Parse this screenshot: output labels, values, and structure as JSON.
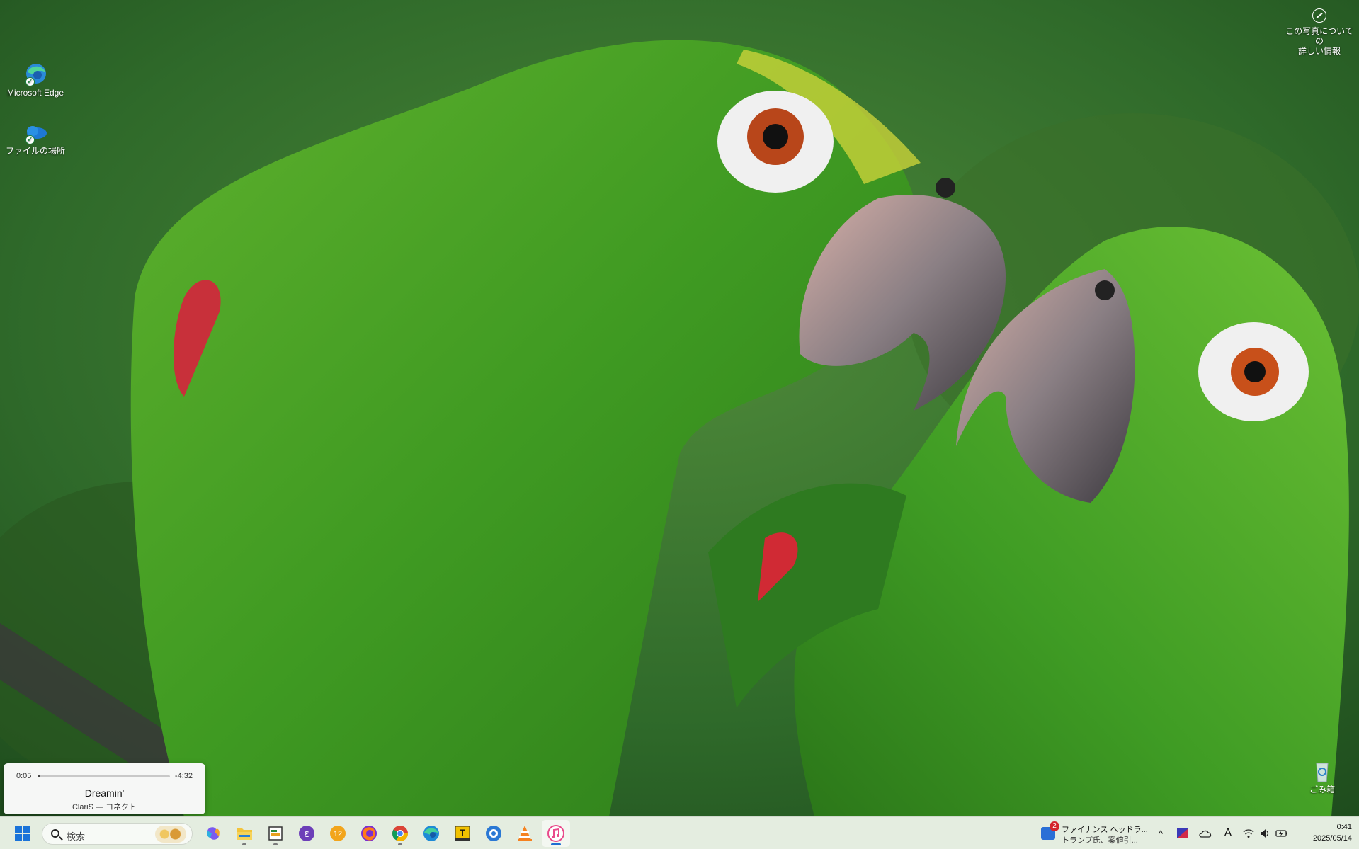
{
  "desktop": {
    "icons": [
      {
        "label": "Microsoft Edge",
        "icon": "edge-icon"
      },
      {
        "label": "ファイルの場所",
        "icon": "onedrive-icon"
      },
      {
        "label": "ごみ箱",
        "icon": "recycle-bin-icon"
      }
    ],
    "photo_info_label": "この写真についての\n詳しい情報"
  },
  "media_player": {
    "elapsed": "0:05",
    "remaining": "-4:32",
    "progress": 0.02,
    "title": "Dreamin'",
    "artist_album": "ClariS — コネクト"
  },
  "taskbar": {
    "search_placeholder": "検索",
    "apps": [
      {
        "name": "copilot-icon"
      },
      {
        "name": "file-explorer-icon",
        "running": true
      },
      {
        "name": "app-launcher-icon",
        "running": true
      },
      {
        "name": "purple-app-icon"
      },
      {
        "name": "orange-12-app-icon",
        "label": "12"
      },
      {
        "name": "firefox-icon"
      },
      {
        "name": "chrome-icon",
        "running": true
      },
      {
        "name": "edge-taskbar-icon"
      },
      {
        "name": "text-editor-icon",
        "label": "T"
      },
      {
        "name": "blue-app-icon"
      },
      {
        "name": "vlc-icon"
      },
      {
        "name": "music-app-icon",
        "running": true,
        "active": true
      }
    ],
    "news": {
      "badge_count": "2",
      "headline": "ファイナンス ヘッドラ...",
      "subline": "トランプ氏、案値引..."
    },
    "tray": {
      "chevron": "^",
      "ime_label": "A"
    },
    "clock": {
      "time": "0:41",
      "date": "2025/05/14"
    }
  },
  "colors": {
    "taskbar_bg": "#e4ede0",
    "accent_blue": "#1f6fd1",
    "media_bg": "#f6f7f6"
  }
}
